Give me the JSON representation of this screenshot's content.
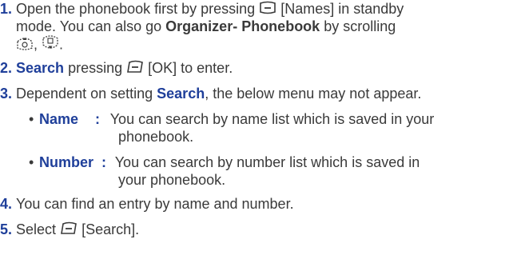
{
  "steps": [
    {
      "number": "1.",
      "before_icon": "Open the phonebook first by pressing",
      "icon": "right-soft-key-icon",
      "after_icon": "[Names] in standby",
      "line2_before": "mode. You can also go",
      "line2_bold": "Organizer- Phonebook",
      "line2_after": "by scrolling",
      "line3_icons": [
        "nav-up-key-icon",
        "nav-down-key-icon"
      ],
      "line3_sep": ",",
      "line3_end": "."
    },
    {
      "number": "2.",
      "bold": "Search",
      "before_icon": "pressing",
      "icon": "left-soft-key-icon",
      "after_icon": "[OK] to enter."
    },
    {
      "number": "3.",
      "before_bold": "Dependent on setting",
      "bold": "Search",
      "after_bold": ", the below menu may not appear."
    },
    {
      "number": "4.",
      "text": "You can find an entry by name and number."
    },
    {
      "number": "5.",
      "before_icon": "Select",
      "icon": "left-soft-key-icon",
      "after_icon": "[Search]."
    }
  ],
  "options": [
    {
      "bullet": "•",
      "label": "Name",
      "sep": ":",
      "line1": "You can search by name list which is saved in your",
      "line2": "phonebook."
    },
    {
      "bullet": "•",
      "label": "Number",
      "sep": ":",
      "line1": "You can search by number list which is saved in",
      "line2": "your phonebook."
    }
  ],
  "colors": {
    "text": "#3a3a3a",
    "accent": "#1f3f9a"
  }
}
